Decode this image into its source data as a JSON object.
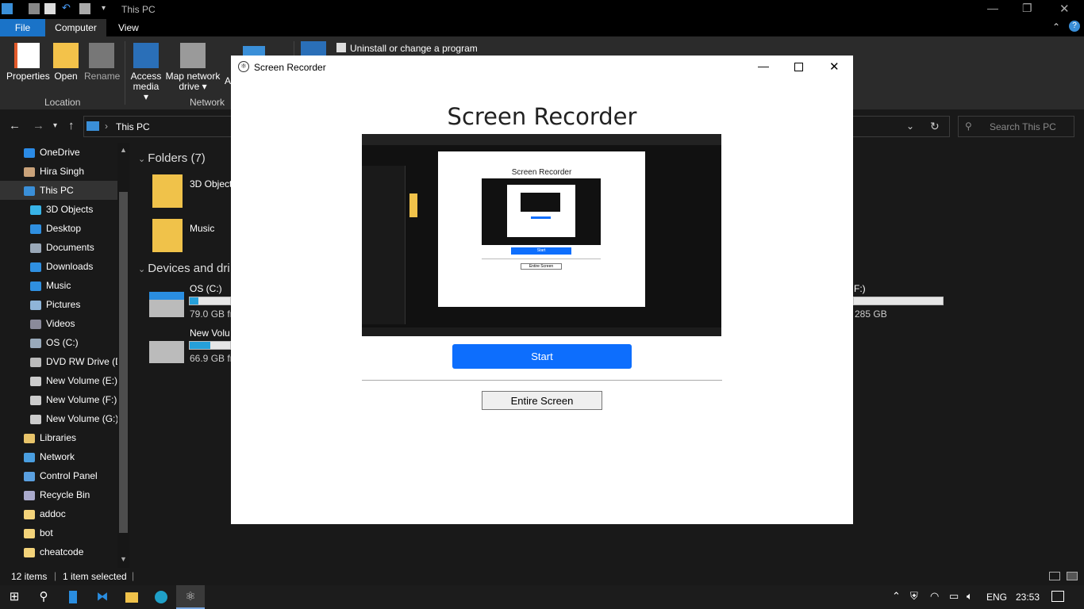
{
  "explorer": {
    "window_title": "This PC",
    "tabs": {
      "file": "File",
      "computer": "Computer",
      "view": "View"
    },
    "ribbon": {
      "properties": "Properties",
      "open": "Open",
      "rename": "Rename",
      "access_media_1": "Access",
      "access_media_2": "media",
      "map_drive_1": "Map network",
      "map_drive_2": "drive",
      "add_partial": "A",
      "uninstall": "Uninstall or change a program",
      "group_location": "Location",
      "group_network": "Network"
    },
    "address": {
      "path": "This PC",
      "search_placeholder": "Search This PC"
    },
    "nav_items": [
      {
        "label": "OneDrive",
        "color": "#2b8be6"
      },
      {
        "label": "Hira Singh",
        "color": "#c9a27a"
      },
      {
        "label": "This PC",
        "color": "#3a8fd8"
      },
      {
        "label": "3D Objects",
        "color": "#38b4e8"
      },
      {
        "label": "Desktop",
        "color": "#2f8fe0"
      },
      {
        "label": "Documents",
        "color": "#9aa8b8"
      },
      {
        "label": "Downloads",
        "color": "#2f8fe0"
      },
      {
        "label": "Music",
        "color": "#2f8fe0"
      },
      {
        "label": "Pictures",
        "color": "#8fb5d8"
      },
      {
        "label": "Videos",
        "color": "#8a8a9a"
      },
      {
        "label": "OS (C:)",
        "color": "#9ab"
      },
      {
        "label": "DVD RW Drive (D",
        "color": "#bbb"
      },
      {
        "label": "New Volume (E:)",
        "color": "#ccc"
      },
      {
        "label": "New Volume (F:)",
        "color": "#ccc"
      },
      {
        "label": "New Volume (G:)",
        "color": "#ccc"
      },
      {
        "label": "Libraries",
        "color": "#e8c46a"
      },
      {
        "label": "Network",
        "color": "#4a9ee0"
      },
      {
        "label": "Control Panel",
        "color": "#5aa0e0"
      },
      {
        "label": "Recycle Bin",
        "color": "#aac"
      },
      {
        "label": "addoc",
        "color": "#f3d37a"
      },
      {
        "label": "bot",
        "color": "#f3d37a"
      },
      {
        "label": "cheatcode",
        "color": "#f3d37a"
      }
    ],
    "content": {
      "folders_header": "Folders (7)",
      "folder_3d": "3D Object",
      "folder_music": "Music",
      "devices_header": "Devices and dri",
      "drive_c_name": "OS (C:)",
      "drive_c_free": "79.0 GB fr",
      "drive_c_fill": 0.22,
      "drive_e_name": "New Volu",
      "drive_e_free": "66.9 GB fr",
      "drive_e_fill": 0.5,
      "drive_f_name": "F:)",
      "drive_f_free": "285 GB"
    },
    "status": {
      "items": "12 items",
      "selected": "1 item selected"
    }
  },
  "dialog": {
    "title": "Screen Recorder",
    "heading": "Screen Recorder",
    "start": "Start",
    "entire_screen": "Entire Screen",
    "preview_heading": "Screen Recorder",
    "preview_start": "Start",
    "preview_entire": "Entire Screen"
  },
  "taskbar": {
    "lang": "ENG",
    "time": "23:53"
  }
}
